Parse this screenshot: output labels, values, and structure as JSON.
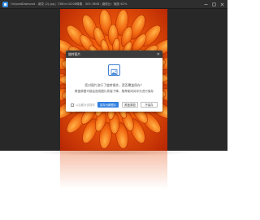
{
  "window": {
    "app_name": "OnlyeatDiamond",
    "file_info": "菊花 (2).jpg",
    "dimensions": "7360×10208像素",
    "file_size": "305.78KB",
    "zoom_info": "缩放比：缩放 62%",
    "controls": [
      "minimize-icon",
      "maximize-icon",
      "close-icon"
    ]
  },
  "dialog": {
    "title": "旋转图片",
    "close_glyph": "✕",
    "message_line1": "您对图片进行了旋转操作，是否覆盖保存？",
    "message_line2": "覆盖原图可能会造成图片质量下降，推荐使用另存为进行保存",
    "checkbox_label": "以后都对该操作",
    "checkbox_checked": false,
    "buttons": {
      "save_as": "另存为新图片",
      "overwrite": "覆盖原图",
      "cancel": "不保存"
    },
    "accent_color": "#2f7fe0"
  }
}
